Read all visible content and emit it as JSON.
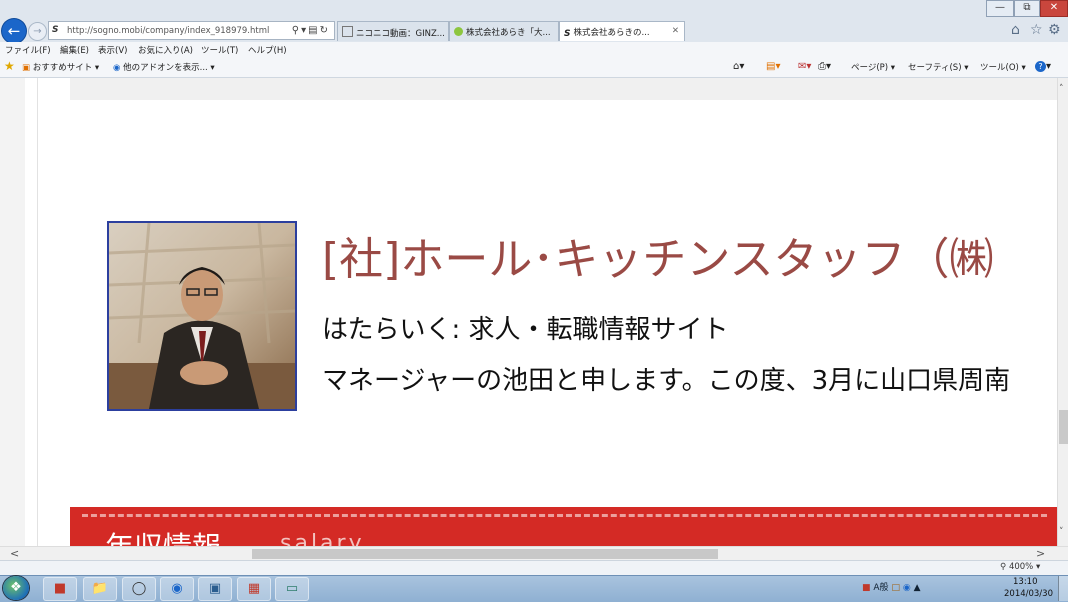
{
  "browser": {
    "url": "http://sogno.mobi/company/index_918979.html",
    "tabs": [
      {
        "label": "ニコニコ動画：GINZ...",
        "active": false
      },
      {
        "label": "株式会社あらき「大...",
        "active": false
      },
      {
        "label": "株式会社あらきの...",
        "active": true
      }
    ],
    "menu": [
      "ファイル(F)",
      "編集(E)",
      "表示(V)",
      "お気に入り(A)",
      "ツール(T)",
      "ヘルプ(H)"
    ],
    "favorites": [
      "おすすめサイト ▾",
      "他のアドオンを表示... ▾"
    ],
    "commands": [
      "ページ(P) ▾",
      "セーフティ(S) ▾",
      "ツール(O) ▾"
    ],
    "zoom": "400%"
  },
  "page": {
    "company": "[社]ホール･キッチンスタッフ（㈱",
    "site": "はたらいく: 求人・転職情報サイト",
    "message": "マネージャーの池田と申します。この度、3月に山口県周南",
    "salary_ja": "年収情報",
    "salary_en": "salary"
  },
  "taskbar": {
    "time": "13:10",
    "date": "2014/03/30"
  },
  "colors": {
    "heading": "#9a4a45",
    "salary_band": "#d42a25",
    "photo_border": "#2c3f9e"
  },
  "icons": [
    "back-arrow-icon",
    "forward-arrow-icon",
    "search-icon",
    "refresh-icon",
    "home-icon",
    "star-icon",
    "gear-icon",
    "print-icon",
    "rss-icon",
    "mail-icon",
    "help-icon",
    "windows-start-icon"
  ]
}
